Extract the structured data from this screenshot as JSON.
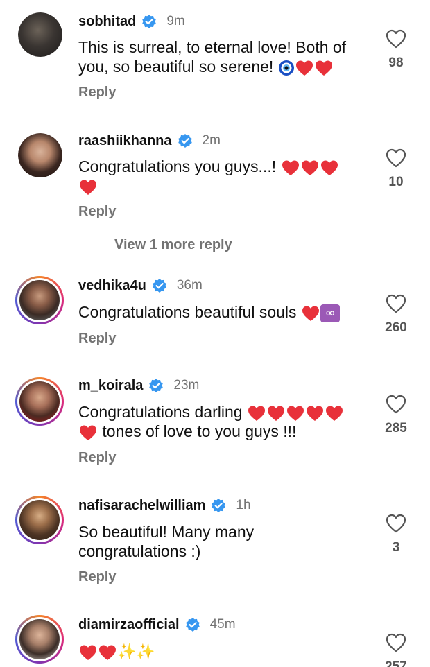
{
  "colors": {
    "verified": "#3797f0",
    "muted": "#737373",
    "heart": "#e8313a",
    "ring": "#dd2a7b"
  },
  "comments": [
    {
      "username": "sobhitad",
      "time": "9m",
      "line1": "This is surreal, to eternal love! Both of",
      "line2": "you, so beautiful so serene!",
      "likes": "98",
      "reply": "Reply"
    },
    {
      "username": "raashiikhanna",
      "time": "2m",
      "line1": "Congratulations you guys...!",
      "likes": "10",
      "reply": "Reply"
    },
    {
      "username": "vedhika4u",
      "time": "36m",
      "line1": "Congratulations beautiful souls",
      "likes": "260",
      "reply": "Reply"
    },
    {
      "username": "m_koirala",
      "time": "23m",
      "line1": "Congratulations darling",
      "line2": "tones of love to you guys !!!",
      "likes": "285",
      "reply": "Reply"
    },
    {
      "username": "nafisarachelwilliam",
      "time": "1h",
      "line1": "So beautiful! Many many",
      "line2": "congratulations :)",
      "likes": "3",
      "reply": "Reply"
    },
    {
      "username": "diamirzaofficial",
      "time": "45m",
      "likes": "257"
    }
  ],
  "view_more": "View 1 more reply"
}
